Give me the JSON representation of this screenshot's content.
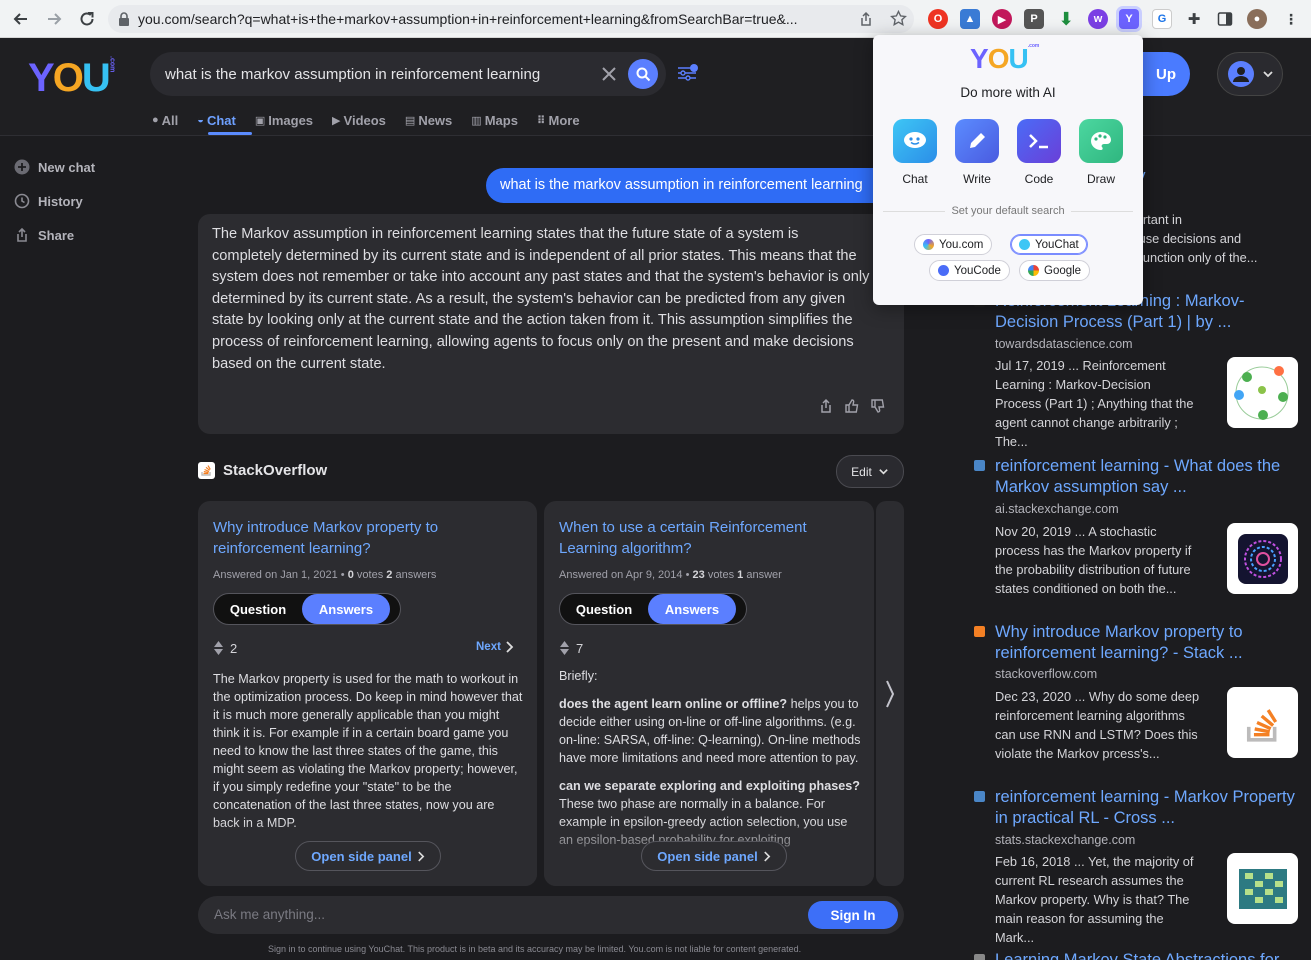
{
  "browser": {
    "url": "you.com/search?q=what+is+the+markov+assumption+in+reinforcement+learning&fromSearchBar=true&..."
  },
  "header": {
    "logo": {
      "y": "Y",
      "o": "O",
      "u": "U",
      "suffix": ".com"
    },
    "search_value": "what is the markov assumption in reinforcement learning",
    "tabs": [
      {
        "label": "All",
        "icon": "search-icon"
      },
      {
        "label": "Chat",
        "icon": "chat-icon"
      },
      {
        "label": "Images",
        "icon": "image-icon"
      },
      {
        "label": "Videos",
        "icon": "play-icon"
      },
      {
        "label": "News",
        "icon": "news-icon"
      },
      {
        "label": "Maps",
        "icon": "map-icon"
      },
      {
        "label": "More",
        "icon": "dots-icon"
      }
    ],
    "signup_label": "Up"
  },
  "sidebar": {
    "items": [
      {
        "label": "New chat",
        "icon": "plus-circle-icon"
      },
      {
        "label": "History",
        "icon": "history-icon"
      },
      {
        "label": "Share",
        "icon": "share-icon"
      }
    ]
  },
  "chat": {
    "user_message": "what is the markov assumption in reinforcement learning",
    "answer": "The Markov assumption in reinforcement learning states that the future state of a system is completely determined by its current state and is independent of all prior states. This means that the system does not remember or take into account any past states and that the system's behavior is only determined by its current state. As a result, the system's behavior can be predicted from any given state by looking only at the current state and the action taken from it. This assumption simplifies the process of reinforcement learning, allowing agents to focus only on the present and make decisions based on the current state."
  },
  "stackoverflow": {
    "title": "StackOverflow",
    "edit_label": "Edit",
    "cards": [
      {
        "title": "Why introduce Markov property to reinforcement learning?",
        "answered": "Answered on Jan 1, 2021 •",
        "votes": "0",
        "votes_label": "votes",
        "answers": "2",
        "answers_label": "answers",
        "question_tab": "Question",
        "answers_tab": "Answers",
        "score": "2",
        "next_label": "Next",
        "body": "The Markov property is used for the math to workout in the optimization process. Do keep in mind however that it is much more generally applicable than you might think it is. For example if in a certain board game you need to know the last three states of the game, this might seem as violating the Markov property; however, if you simply redefine your \"state\" to be the concatenation of the last three states, now you are back in a MDP.",
        "open_panel": "Open side panel"
      },
      {
        "title": "When to use a certain Reinforcement Learning algorithm?",
        "answered": "Answered on Apr 9, 2014 •",
        "votes": "23",
        "votes_label": "votes",
        "answers": "1",
        "answers_label": "answer",
        "question_tab": "Question",
        "answers_tab": "Answers",
        "score": "7",
        "intro": "Briefly:",
        "p1_bold": "does the agent learn online or offline?",
        "p1_rest": " helps you to decide either using on-line or off-line algorithms. (e.g. on-line: SARSA, off-line: Q-learning). On-line methods have more limitations and need more attention to pay.",
        "p2_bold": "can we separate exploring and exploiting phases?",
        "p2_rest": " These two phase are normally in a balance. For example in epsilon-greedy action selection, you use an epsilon-based probability for exploiting",
        "open_panel": "Open side panel"
      }
    ]
  },
  "input": {
    "placeholder": "Ask me anything...",
    "signin_label": "Sign In",
    "disclaimer": "Sign in to continue using YouChat. This product is in beta and its accuracy may be limited. You.com is not liable for content generated."
  },
  "results": [
    {
      "title_partial": "erty",
      "snippet_partial": [
        "mportant in",
        "ecause decisions and",
        "e a function only of the..."
      ]
    },
    {
      "title": "Reinforcement Learning : Markov-Decision Process (Part 1) | by ...",
      "domain": "towardsdatascience.com",
      "snippet": "Jul 17, 2019 ... Reinforcement Learning : Markov-Decision Process (Part 1) ; Anything that the agent cannot change arbitrarily ; The..."
    },
    {
      "title": "reinforcement learning - What does the Markov assumption say ...",
      "domain": "ai.stackexchange.com",
      "snippet": "Nov 20, 2019 ... A stochastic process has the Markov property if the probability distribution of future states conditioned on both the..."
    },
    {
      "title": "Why introduce Markov property to reinforcement learning? - Stack ...",
      "domain": "stackoverflow.com",
      "snippet": "Dec 23, 2020 ... Why do some deep reinforcement learning algorithms can use RNN and LSTM? Does this violate the Markov prcess's..."
    },
    {
      "title": "reinforcement learning - Markov Property in practical RL - Cross ...",
      "domain": "stats.stackexchange.com",
      "snippet": "Feb 16, 2018 ... Yet, the majority of current RL research assumes the Markov property. Why is that? The main reason for assuming the Mark..."
    },
    {
      "title": "Learning Markov State Abstractions for ..."
    }
  ],
  "popup": {
    "logo": {
      "y": "Y",
      "o": "O",
      "u": "U",
      "suffix": ".com"
    },
    "title": "Do more with AI",
    "tools": [
      "Chat",
      "Write",
      "Code",
      "Draw"
    ],
    "subtitle": "Set your default search",
    "engines": [
      "You.com",
      "YouChat",
      "YouCode",
      "Google"
    ],
    "selected_engine": "YouChat"
  },
  "colors": {
    "accent": "#5b7fff",
    "link": "#6ea8ff",
    "background": "#1c1c1f"
  }
}
